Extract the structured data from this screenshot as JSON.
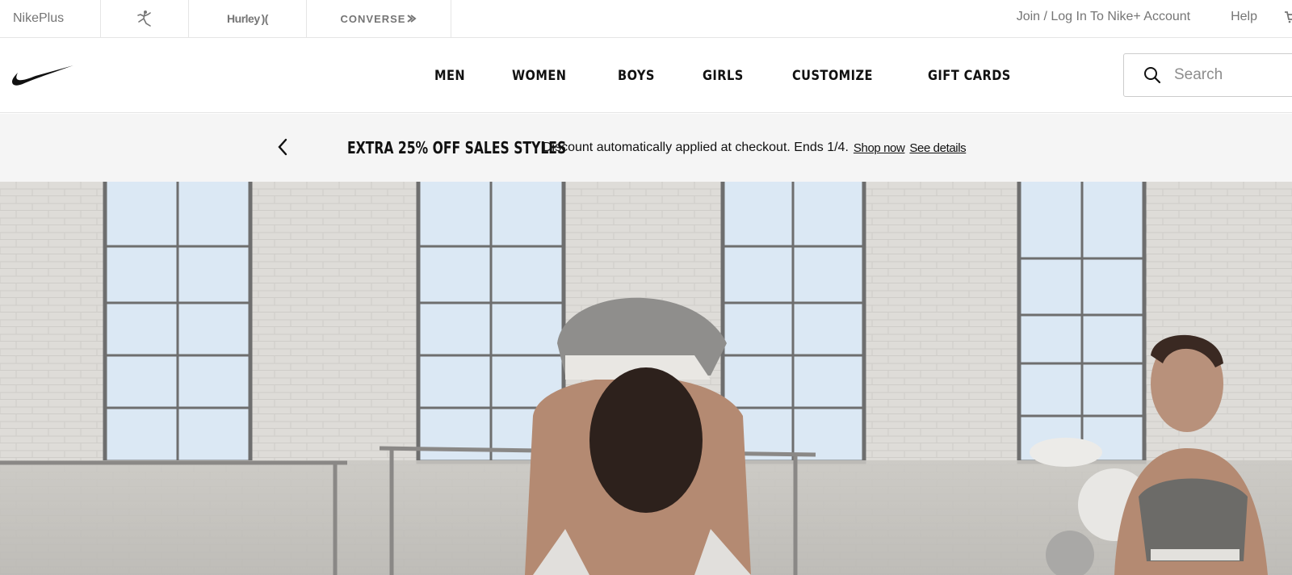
{
  "utility_bar": {
    "brands": {
      "nikeplus": "NikePlus",
      "jordan": "jordan-jumpman-logo",
      "hurley": "Hurley",
      "converse": "CONVERSE"
    },
    "login_label": "Join / Log In To Nike+ Account",
    "help_label": "Help",
    "cart_icon": "cart-icon"
  },
  "main_nav": {
    "logo": "nike-swoosh-logo",
    "links": [
      "MEN",
      "WOMEN",
      "BOYS",
      "GIRLS",
      "CUSTOMIZE",
      "GIFT CARDS"
    ],
    "search": {
      "placeholder": "Search",
      "icon": "search-icon"
    }
  },
  "promo": {
    "headline": "EXTRA 25% OFF SALES STYLES",
    "text": "Discount automatically applied at checkout. Ends 1/4.",
    "shop_link": "Shop now",
    "details_link": "See details",
    "prev_icon": "chevron-left-icon"
  },
  "hero": {
    "image": "women training in a bright studio with tall windows and ballet barres"
  },
  "colors": {
    "text_primary": "#111111",
    "text_secondary": "#757575",
    "promo_bg": "#f5f5f5",
    "border": "#e5e5e5"
  }
}
